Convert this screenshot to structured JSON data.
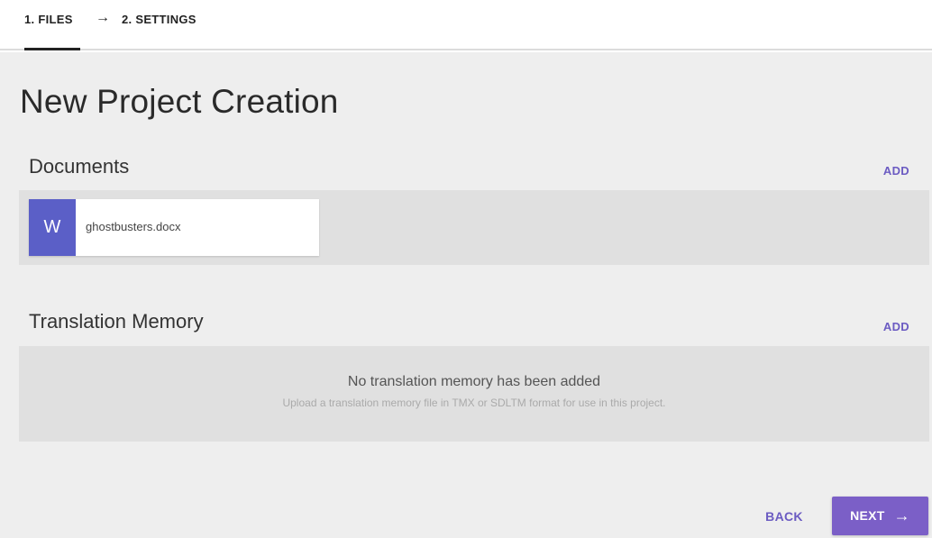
{
  "stepper": {
    "step1": "1. FILES",
    "arrow": "→",
    "step2": "2. SETTINGS"
  },
  "page": {
    "title": "New Project Creation"
  },
  "documents": {
    "heading": "Documents",
    "add_label": "ADD",
    "files": [
      {
        "type_letter": "W",
        "name": "ghostbusters.docx"
      }
    ]
  },
  "translation_memory": {
    "heading": "Translation Memory",
    "add_label": "ADD",
    "empty_title": "No translation memory has been added",
    "empty_subtitle": "Upload a translation memory file in TMX or SDLTM format for use in this project."
  },
  "footer": {
    "back_label": "BACK",
    "next_label": "NEXT",
    "next_arrow": "→"
  },
  "colors": {
    "accent": "#6b5bc2",
    "primary_button": "#7b5fc7",
    "file_icon": "#5b5fc7",
    "background": "#eeeeee",
    "panel": "#e0e0e0"
  }
}
